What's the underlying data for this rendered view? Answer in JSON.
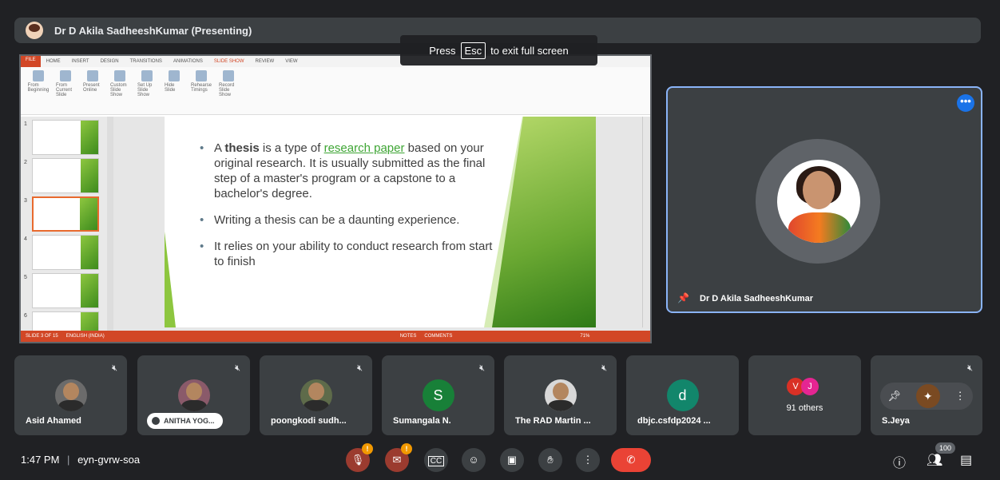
{
  "header": {
    "presenter_title": "Dr D Akila SadheeshKumar (Presenting)"
  },
  "toast": {
    "press": "Press",
    "key": "Esc",
    "suffix": "to exit full screen"
  },
  "ppt": {
    "tabs": [
      "FILE",
      "HOME",
      "INSERT",
      "DESIGN",
      "TRANSITIONS",
      "ANIMATIONS",
      "SLIDE SHOW",
      "REVIEW",
      "VIEW"
    ],
    "active_tab": "SLIDE SHOW",
    "ribbon_buttons": [
      "From Beginning",
      "From Current Slide",
      "Present Online",
      "Custom Slide Show",
      "Set Up Slide Show",
      "Hide Slide",
      "Rehearse Timings",
      "Record Slide Show"
    ],
    "thumbnail_numbers": [
      "1",
      "2",
      "3",
      "4",
      "5",
      "6"
    ],
    "slide": {
      "bullet1_prefix": "A ",
      "bullet1_bold": "thesis",
      "bullet1_mid": " is a type of ",
      "bullet1_link": "research paper",
      "bullet1_rest": " based on your original research. It is usually submitted as the final step of a master's program or a capstone to a bachelor's degree.",
      "bullet2": "Writing a thesis can be a daunting experience.",
      "bullet3": "It relies on your ability to conduct research from start to finish"
    },
    "status_left": "SLIDE 3 OF 15",
    "status_lang": "ENGLISH (INDIA)",
    "status_notes": "NOTES",
    "status_comments": "COMMENTS",
    "zoom": "71%"
  },
  "presenter": {
    "name": "Dr D Akila SadheeshKumar",
    "more_glyph": "•••"
  },
  "participants": [
    {
      "name": "Asid Ahamed"
    },
    {
      "name": "ANITHA YOG..."
    },
    {
      "name": "poongkodi sudh..."
    },
    {
      "name": "Sumangala N.",
      "letter": "S",
      "color": "#188038"
    },
    {
      "name": "The RAD Martin ..."
    },
    {
      "name": "dbjc.csfdp2024 ...",
      "letter": "d",
      "color": "#12866b"
    },
    {
      "name": "91 others",
      "letters": [
        "V",
        "J"
      ],
      "colors": [
        "#d93025",
        "#e52592"
      ]
    },
    {
      "name": "S.Jeya"
    }
  ],
  "footer": {
    "time": "1:47 PM",
    "separator": "|",
    "meeting_code": "eyn-gvrw-soa",
    "people_count": "100"
  }
}
